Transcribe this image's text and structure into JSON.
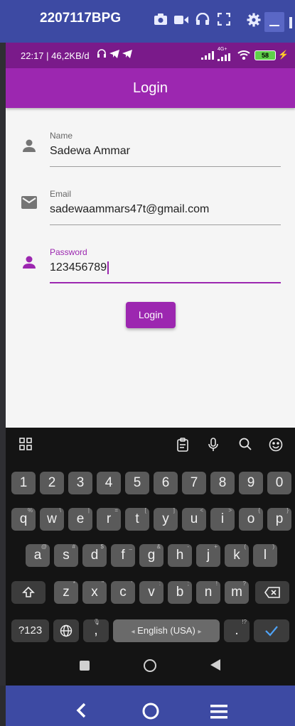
{
  "scrcpy": {
    "device_name": "2207117BPG",
    "icons": [
      "camera-icon",
      "video-icon",
      "headphones-icon",
      "fullscreen-icon",
      "settings-icon",
      "minimize-icon",
      "more-icon"
    ]
  },
  "status": {
    "time_speed": "22:17 | 46,2KB/d",
    "network": "4G+",
    "battery": "58"
  },
  "app": {
    "title": "Login",
    "fields": {
      "name": {
        "label": "Name",
        "value": "Sadewa Ammar"
      },
      "email": {
        "label": "Email",
        "value": "sadewaammars47t@gmail.com"
      },
      "password": {
        "label": "Password",
        "value": "123456789"
      }
    },
    "login_button": "Login",
    "accent_color": "#9c27b0"
  },
  "keyboard": {
    "numbers": [
      "1",
      "2",
      "3",
      "4",
      "5",
      "6",
      "7",
      "8",
      "9",
      "0"
    ],
    "row1": [
      [
        "q",
        "%"
      ],
      [
        "w",
        "\\"
      ],
      [
        "e",
        "|"
      ],
      [
        "r",
        "="
      ],
      [
        "t",
        "["
      ],
      [
        "y",
        "]"
      ],
      [
        "u",
        "<"
      ],
      [
        "i",
        ">"
      ],
      [
        "o",
        "{"
      ],
      [
        "p",
        "}"
      ]
    ],
    "row2": [
      [
        "a",
        "@"
      ],
      [
        "s",
        "#"
      ],
      [
        "d",
        "$"
      ],
      [
        "f",
        "_"
      ],
      [
        "g",
        "&"
      ],
      [
        "h",
        "-"
      ],
      [
        "j",
        "+"
      ],
      [
        "k",
        "("
      ],
      [
        "l",
        ")"
      ]
    ],
    "row3": [
      [
        "z",
        "*"
      ],
      [
        "x",
        "\""
      ],
      [
        "c",
        "'"
      ],
      [
        "v",
        ":"
      ],
      [
        "b",
        ";"
      ],
      [
        "n",
        "!"
      ],
      [
        "m",
        "?"
      ]
    ],
    "symbols_label": "?123",
    "comma": ",",
    "space_label": "English (USA)",
    "period": ".",
    "period_hint": "!?"
  }
}
